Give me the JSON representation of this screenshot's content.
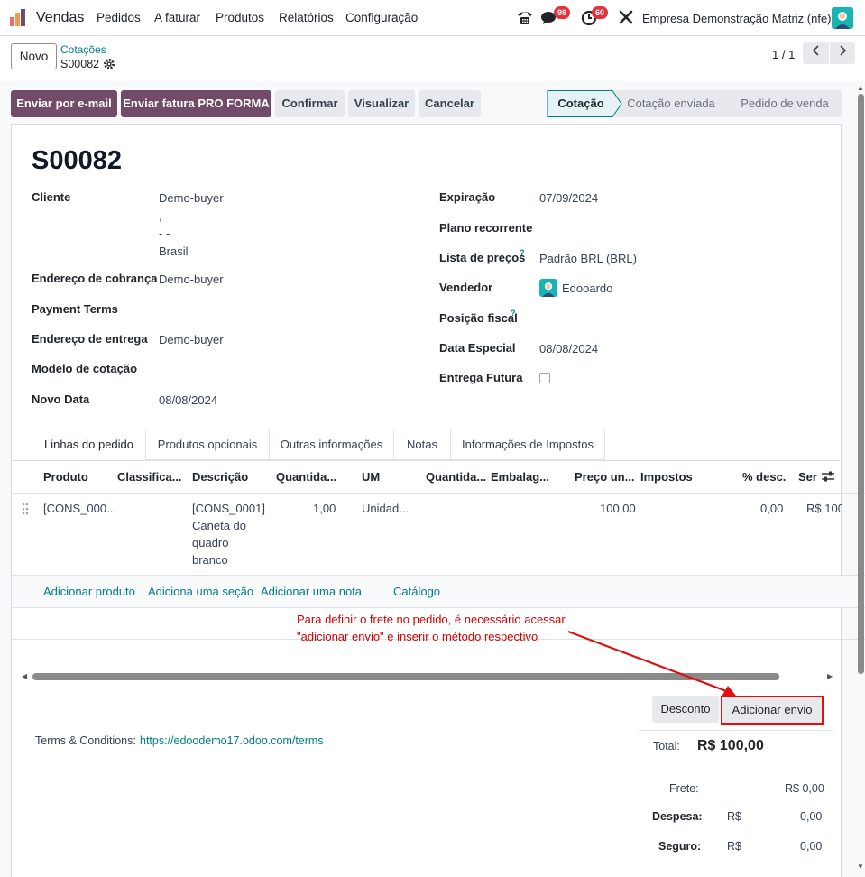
{
  "navbar": {
    "app_name": "Vendas",
    "menus": [
      "Pedidos",
      "A faturar",
      "Produtos",
      "Relatórios",
      "Configuração"
    ],
    "messages_count": "98",
    "activities_count": "60",
    "company": "Empresa Demonstração Matriz (nfe)"
  },
  "control": {
    "new_label": "Novo",
    "breadcrumb_parent": "Cotações",
    "record_name": "S00082",
    "pager": "1 / 1"
  },
  "actions": {
    "email": "Enviar por e-mail",
    "proforma": "Enviar fatura PRO FORMA",
    "confirm": "Confirmar",
    "preview": "Visualizar",
    "cancel": "Cancelar"
  },
  "status": {
    "stages": [
      "Cotação",
      "Cotação enviada",
      "Pedido de venda"
    ],
    "current": "Cotação"
  },
  "form": {
    "title": "S00082",
    "left": {
      "cliente_label": "Cliente",
      "cliente_lines": [
        "Demo-buyer",
        ", -",
        "- -",
        "Brasil"
      ],
      "endereco_cobranca_label": "Endereço de cobrança",
      "endereco_cobranca": "Demo-buyer",
      "payment_terms_label": "Payment Terms",
      "endereco_entrega_label": "Endereço de entrega",
      "endereco_entrega": "Demo-buyer",
      "modelo_label": "Modelo de cotação",
      "novo_data_label": "Novo Data",
      "novo_data": "08/08/2024"
    },
    "right": {
      "expiracao_label": "Expiração",
      "expiracao": "07/09/2024",
      "plano_label": "Plano recorrente",
      "lista_label": "Lista de preços",
      "lista": "Padrão BRL (BRL)",
      "vendedor_label": "Vendedor",
      "vendedor": "Edooardo",
      "posicao_label": "Posição fiscal",
      "data_especial_label": "Data Especial",
      "data_especial": "08/08/2024",
      "entrega_futura_label": "Entrega Futura",
      "help_mark": "?"
    }
  },
  "tabs": [
    "Linhas do pedido",
    "Produtos opcionais",
    "Outras informações",
    "Notas",
    "Informações de Impostos"
  ],
  "table": {
    "headers": [
      "Produto",
      "Classifica...",
      "Descrição",
      "Quantida...",
      "UM",
      "Quantida...",
      "Embalag...",
      "Preço un...",
      "Impostos",
      "% desc.",
      "Ser"
    ],
    "row": {
      "produto": "[CONS_000...",
      "descricao": [
        "[CONS_0001]",
        "Caneta do",
        "quadro",
        "branco"
      ],
      "quantidade": "1,00",
      "um": "Unidad...",
      "preco": "100,00",
      "desc": "0,00",
      "subtotal": "R$ 100"
    },
    "add_product": "Adicionar produto",
    "add_section": "Adiciona uma seção",
    "add_note": "Adicionar uma nota",
    "catalog": "Catálogo"
  },
  "annotation": "Para definir o frete no pedido, é necessário acessar \"adicionar envio\" e inserir o método respectivo",
  "footer": {
    "discount_btn": "Desconto",
    "shipping_btn": "Adicionar envio",
    "terms_label": "Terms & Conditions:",
    "terms_link": "https://edoodemo17.odoo.com/terms",
    "total_label": "Total:",
    "total_value": "R$ 100,00",
    "frete_label": "Frete:",
    "frete_value": "R$ 0,00",
    "despesa_label": "Despesa:",
    "despesa_cur": "R$",
    "despesa_value": "0,00",
    "seguro_label": "Seguro:",
    "seguro_cur": "R$",
    "seguro_value": "0,00"
  },
  "colors": {
    "primary": "#714b67",
    "link": "#017e84",
    "annotation": "#d00000",
    "badge": "#e4313a"
  }
}
